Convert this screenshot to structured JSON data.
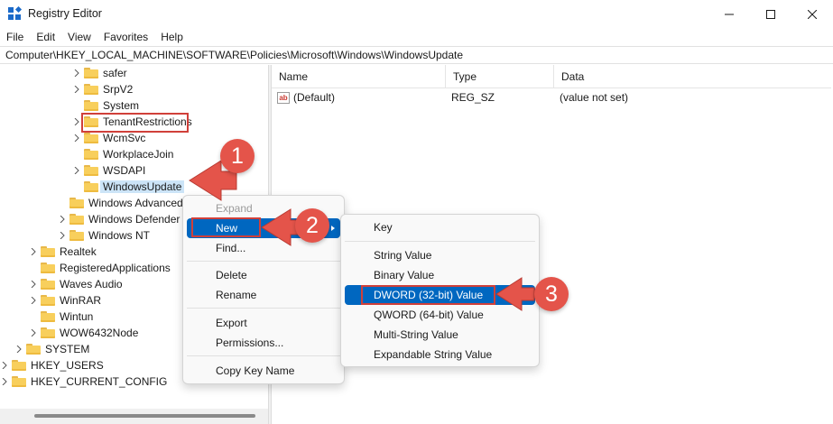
{
  "window": {
    "title": "Registry Editor"
  },
  "menu": [
    "File",
    "Edit",
    "View",
    "Favorites",
    "Help"
  ],
  "address": "Computer\\HKEY_LOCAL_MACHINE\\SOFTWARE\\Policies\\Microsoft\\Windows\\WindowsUpdate",
  "tree": [
    {
      "label": "safer",
      "expander": true
    },
    {
      "label": "SrpV2",
      "expander": true
    },
    {
      "label": "System",
      "expander": false
    },
    {
      "label": "TenantRestrictions",
      "expander": true
    },
    {
      "label": "WcmSvc",
      "expander": true
    },
    {
      "label": "WorkplaceJoin",
      "expander": false
    },
    {
      "label": "WSDAPI",
      "expander": true
    },
    {
      "label": "WindowsUpdate",
      "expander": false,
      "selected": true
    },
    {
      "label": "Windows Advanced",
      "expander": false
    },
    {
      "label": "Windows Defender",
      "expander": true
    },
    {
      "label": "Windows NT",
      "expander": true
    },
    {
      "label": "Realtek",
      "expander": true
    },
    {
      "label": "RegisteredApplications",
      "expander": false
    },
    {
      "label": "Waves Audio",
      "expander": true
    },
    {
      "label": "WinRAR",
      "expander": true
    },
    {
      "label": "Wintun",
      "expander": false
    },
    {
      "label": "WOW6432Node",
      "expander": true
    },
    {
      "label": "SYSTEM",
      "expander": true
    },
    {
      "label": "HKEY_USERS",
      "expander": true
    },
    {
      "label": "HKEY_CURRENT_CONFIG",
      "expander": true
    }
  ],
  "list": {
    "columns": [
      "Name",
      "Type",
      "Data"
    ],
    "rows": [
      {
        "name": "(Default)",
        "type": "REG_SZ",
        "data": "(value not set)"
      }
    ]
  },
  "context_menu": {
    "items": [
      "Expand",
      "New",
      "Find...",
      "Delete",
      "Rename",
      "Export",
      "Permissions...",
      "Copy Key Name"
    ],
    "highlighted": "New",
    "disabled": [
      "Expand"
    ]
  },
  "new_submenu": {
    "items": [
      "Key",
      "String Value",
      "Binary Value",
      "DWORD (32-bit) Value",
      "QWORD (64-bit) Value",
      "Multi-String Value",
      "Expandable String Value"
    ],
    "highlighted": "DWORD (32-bit) Value"
  },
  "annotations": [
    "1",
    "2",
    "3"
  ],
  "colors": {
    "callout": "#e4544a",
    "outline": "#d0403a",
    "highlight": "#0067c0",
    "selection": "#cce4f7",
    "folder": "#f8cf5c"
  },
  "icons": {
    "app": "registry-editor-icon",
    "folder": "folder-icon",
    "value": "string-value-icon"
  }
}
